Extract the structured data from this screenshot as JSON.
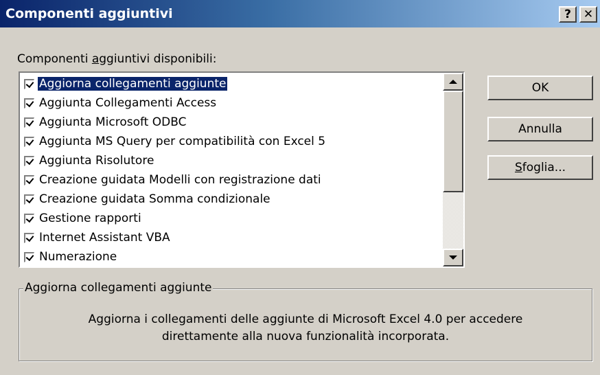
{
  "window": {
    "title": "Componenti aggiuntivi",
    "help_button": "?",
    "close_button": "✕"
  },
  "list": {
    "label_prefix": "Componenti ",
    "label_accel": "a",
    "label_suffix": "ggiuntivi disponibili:",
    "items": [
      {
        "label": "Aggiorna collegamenti aggiunte",
        "checked": true,
        "selected": true
      },
      {
        "label": "Aggiunta Collegamenti Access",
        "checked": true
      },
      {
        "label": "Aggiunta Microsoft ODBC",
        "checked": true
      },
      {
        "label": "Aggiunta MS Query per compatibilità con Excel 5",
        "checked": true
      },
      {
        "label": "Aggiunta Risolutore",
        "checked": true
      },
      {
        "label": "Creazione guidata Modelli con registrazione dati",
        "checked": true
      },
      {
        "label": "Creazione guidata Somma condizionale",
        "checked": true
      },
      {
        "label": "Gestione rapporti",
        "checked": true
      },
      {
        "label": "Internet Assistant VBA",
        "checked": true
      },
      {
        "label": "Numerazione",
        "checked": true
      }
    ]
  },
  "buttons": {
    "ok": "OK",
    "cancel": "Annulla",
    "browse_accel": "S",
    "browse_rest": "foglia..."
  },
  "description": {
    "title": "Aggiorna collegamenti aggiunte",
    "line1": "Aggiorna i collegamenti delle aggiunte di Microsoft Excel 4.0 per accedere",
    "line2": "direttamente alla nuova funzionalità incorporata."
  },
  "colors": {
    "face": "#d4d0c8",
    "title_start": "#0a246a",
    "title_end": "#a6caf0",
    "selection": "#0a246a"
  }
}
